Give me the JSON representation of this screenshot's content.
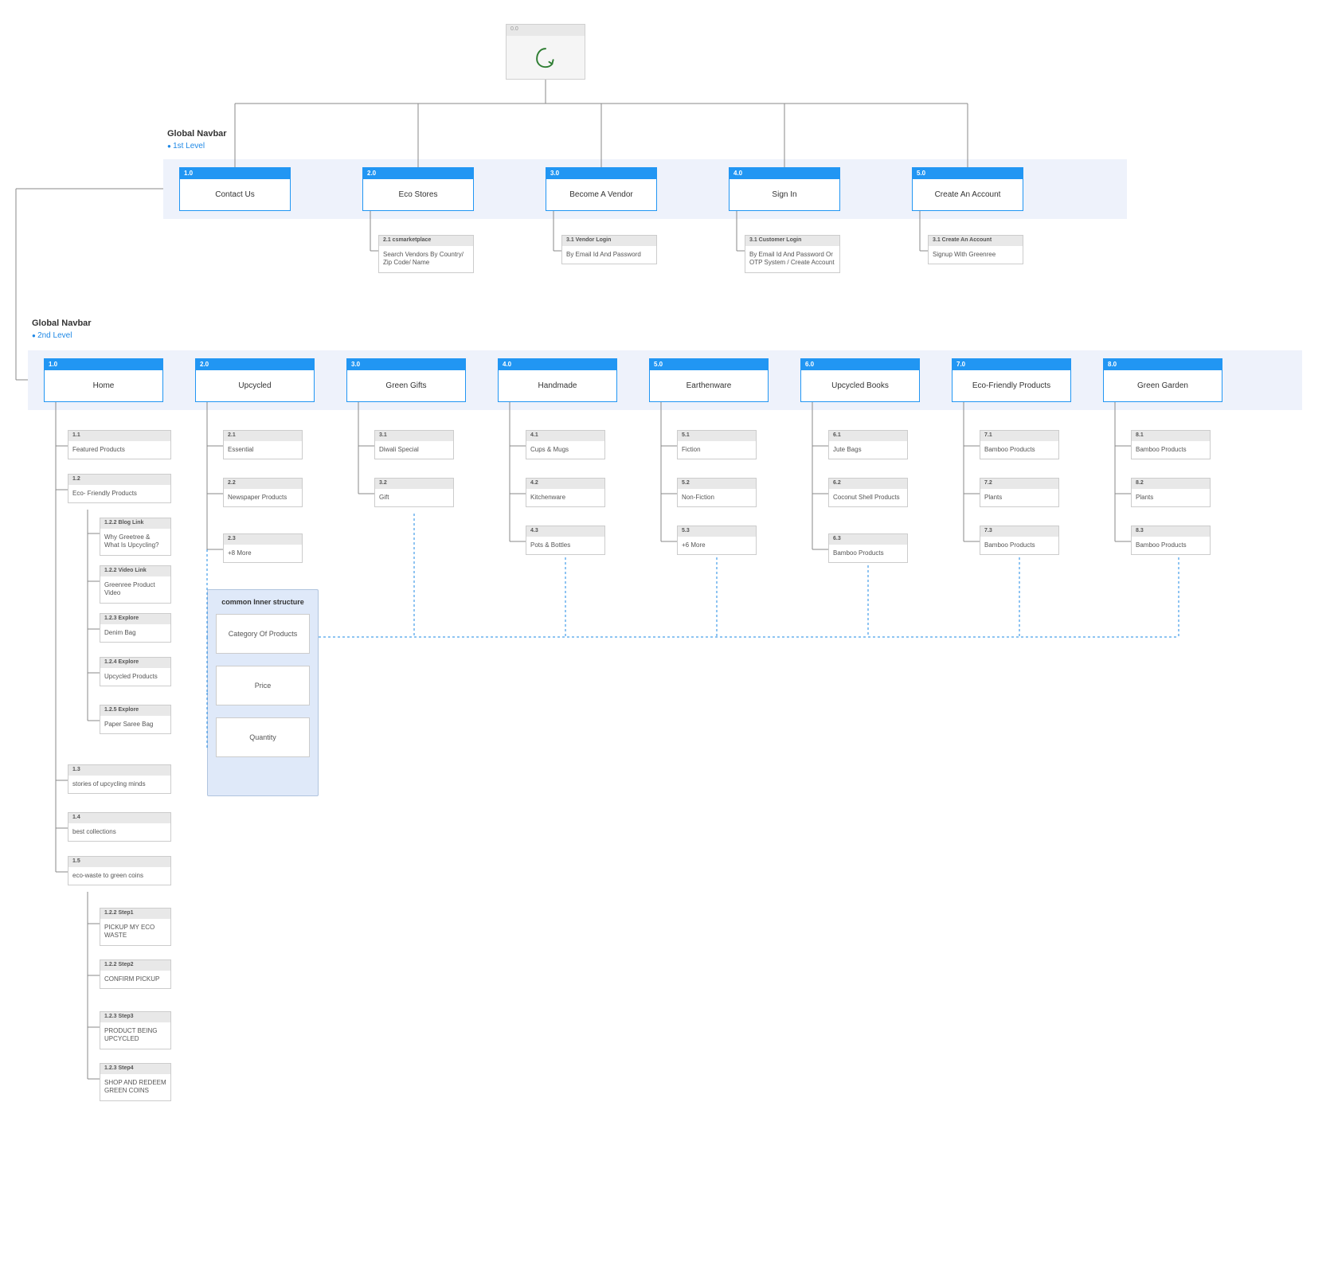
{
  "root": {
    "id": "0.0"
  },
  "sections": {
    "global_navbar_1": "Global Navbar",
    "level1": "1st Level",
    "global_navbar_2": "Global Navbar",
    "level2": "2nd Level"
  },
  "level1": [
    {
      "id": "1.0",
      "label": "Contact Us"
    },
    {
      "id": "2.0",
      "label": "Eco Stores"
    },
    {
      "id": "3.0",
      "label": "Become A Vendor"
    },
    {
      "id": "4.0",
      "label": "Sign In"
    },
    {
      "id": "5.0",
      "label": "Create An Account"
    }
  ],
  "level1_sub": {
    "ecostores": {
      "id": "2.1 csmarketplace",
      "text": "Search Vendors By Country/ Zip Code/ Name"
    },
    "vendor": {
      "id": "3.1 Vendor Login",
      "text": "By Email Id And Password"
    },
    "signin": {
      "id": "3.1 Customer Login",
      "text": "By Email Id And Password Or OTP System / Create Account"
    },
    "create": {
      "id": "3.1 Create An Account",
      "text": "Signup With Greenree"
    }
  },
  "level2": [
    {
      "id": "1.0",
      "label": "Home"
    },
    {
      "id": "2.0",
      "label": "Upcycled"
    },
    {
      "id": "3.0",
      "label": "Green Gifts"
    },
    {
      "id": "4.0",
      "label": "Handmade"
    },
    {
      "id": "5.0",
      "label": "Earthenware"
    },
    {
      "id": "6.0",
      "label": "Upcycled Books"
    },
    {
      "id": "7.0",
      "label": "Eco-Friendly Products"
    },
    {
      "id": "8.0",
      "label": "Green Garden"
    }
  ],
  "home_children": [
    {
      "id": "1.1",
      "label": "Featured Products"
    },
    {
      "id": "1.2",
      "label": "Eco- Friendly Products"
    },
    {
      "id": "1.3",
      "label": "stories of upcycling minds"
    },
    {
      "id": "1.4",
      "label": "best collections"
    },
    {
      "id": "1.5",
      "label": "eco-waste to green coins"
    }
  ],
  "home_1_2_children": [
    {
      "id": "1.2.2 Blog Link",
      "label": "Why Greetree & What Is Upcycling?"
    },
    {
      "id": "1.2.2 Video Link",
      "label": "Greenree Product Video"
    },
    {
      "id": "1.2.3 Explore",
      "label": "Denim Bag"
    },
    {
      "id": "1.2.4 Explore",
      "label": "Upcycled Products"
    },
    {
      "id": "1.2.5 Explore",
      "label": "Paper Saree Bag"
    }
  ],
  "home_1_5_children": [
    {
      "id": "1.2.2 Step1",
      "label": "PICKUP MY ECO WASTE"
    },
    {
      "id": "1.2.2 Step2",
      "label": "CONFIRM PICKUP"
    },
    {
      "id": "1.2.3 Step3",
      "label": "PRODUCT BEING UPCYCLED"
    },
    {
      "id": "1.2.3 Step4",
      "label": "SHOP AND REDEEM GREEN COINS"
    }
  ],
  "upcycled_children": [
    {
      "id": "2.1",
      "label": "Essential"
    },
    {
      "id": "2.2",
      "label": "Newspaper Products"
    },
    {
      "id": "2.3",
      "label": "+8 More"
    }
  ],
  "greengifts_children": [
    {
      "id": "3.1",
      "label": "Diwali Special"
    },
    {
      "id": "3.2",
      "label": "Gift"
    }
  ],
  "handmade_children": [
    {
      "id": "4.1",
      "label": "Cups & Mugs"
    },
    {
      "id": "4.2",
      "label": "Kitchenware"
    },
    {
      "id": "4.3",
      "label": "Pots & Bottles"
    }
  ],
  "earthenware_children": [
    {
      "id": "5.1",
      "label": "Fiction"
    },
    {
      "id": "5.2",
      "label": "Non-Fiction"
    },
    {
      "id": "5.3",
      "label": "+6 More"
    }
  ],
  "upcycledbooks_children": [
    {
      "id": "6.1",
      "label": "Jute Bags"
    },
    {
      "id": "6.2",
      "label": "Coconut Shell Products"
    },
    {
      "id": "6.3",
      "label": "Bamboo Products"
    }
  ],
  "ecofriendly_children": [
    {
      "id": "7.1",
      "label": "Bamboo Products"
    },
    {
      "id": "7.2",
      "label": "Plants"
    },
    {
      "id": "7.3",
      "label": "Bamboo Products"
    }
  ],
  "greengarden_children": [
    {
      "id": "8.1",
      "label": "Bamboo Products"
    },
    {
      "id": "8.2",
      "label": "Plants"
    },
    {
      "id": "8.3",
      "label": "Bamboo Products"
    }
  ],
  "inner": {
    "title": "common Inner structure",
    "items": [
      "Category Of Products",
      "Price",
      "Quantity"
    ]
  }
}
